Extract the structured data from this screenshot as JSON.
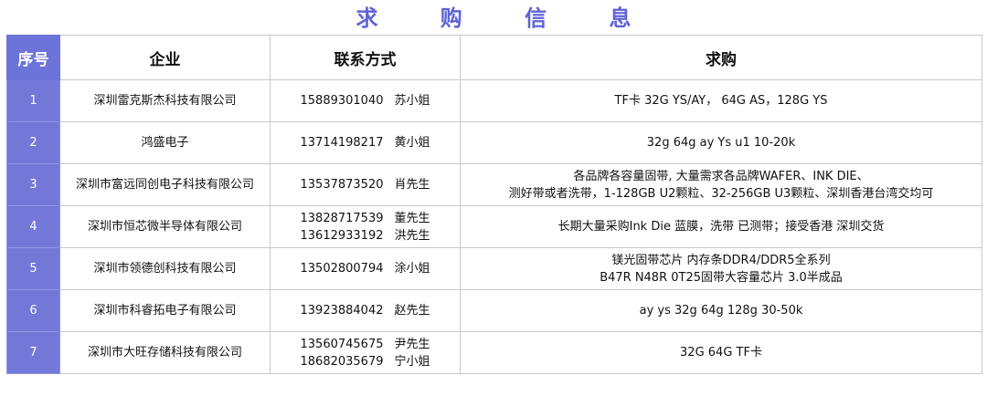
{
  "title": "求 购 信 息",
  "headers": {
    "no": "序号",
    "company": "企业",
    "contact": "联系方式",
    "demand": "求购"
  },
  "rows": [
    {
      "no": "1",
      "company": "深圳雷克斯杰科技有限公司",
      "contacts": [
        {
          "phone": "15889301040",
          "name": "苏小姐"
        }
      ],
      "demand": [
        "TF卡 32G YS/AY， 64G AS，128G YS"
      ]
    },
    {
      "no": "2",
      "company": "鸿盛电子",
      "contacts": [
        {
          "phone": "13714198217",
          "name": "黄小姐"
        }
      ],
      "demand": [
        "32g 64g ay Ys u1 10-20k"
      ]
    },
    {
      "no": "3",
      "company": "深圳市富远同创电子科技有限公司",
      "contacts": [
        {
          "phone": "13537873520",
          "name": "肖先生"
        }
      ],
      "demand": [
        "各品牌各容量固带, 大量需求各品牌WAFER、INK DIE、",
        "测好带或者洗带，1-128GB U2颗粒、32-256GB U3颗粒、深圳香港台湾交均可"
      ]
    },
    {
      "no": "4",
      "company": "深圳市恒芯微半导体有限公司",
      "contacts": [
        {
          "phone": "13828717539",
          "name": "董先生"
        },
        {
          "phone": "13612933192",
          "name": "洪先生"
        }
      ],
      "demand": [
        "长期大量采购Ink Die 蓝膜，洗带 已测带；接受香港 深圳交货"
      ]
    },
    {
      "no": "5",
      "company": "深圳市领德创科技有限公司",
      "contacts": [
        {
          "phone": "13502800794",
          "name": "涂小姐"
        }
      ],
      "demand": [
        "镁光固带芯片  内存条DDR4/DDR5全系列",
        "B47R N48R 0T25固带大容量芯片  3.0半成品"
      ]
    },
    {
      "no": "6",
      "company": "深圳市科睿拓电子有限公司",
      "contacts": [
        {
          "phone": "13923884042",
          "name": "赵先生"
        }
      ],
      "demand": [
        "ay  ys  32g  64g  128g  30-50k"
      ]
    },
    {
      "no": "7",
      "company": "深圳市大旺存储科技有限公司",
      "contacts": [
        {
          "phone": "13560745675",
          "name": "尹先生"
        },
        {
          "phone": "18682035679",
          "name": "宁小姐"
        }
      ],
      "demand": [
        "32G 64G TF卡"
      ]
    }
  ]
}
